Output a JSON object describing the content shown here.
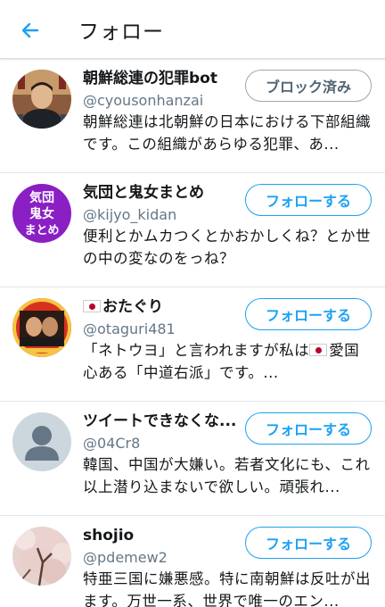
{
  "header": {
    "title": "フォロー"
  },
  "users": [
    {
      "name": "朝鮮総連の犯罪bot",
      "handle": "@cyousonhanzai",
      "bio": "朝鮮総連は北朝鮮の日本における下部組織です。この組織があらゆる犯罪、あ...",
      "button": "ブロック済み",
      "avatar": "portrait-photo-icon"
    },
    {
      "name": "気団と鬼女まとめ",
      "handle": "@kijyo_kidan",
      "bio": "便利とかムカつくとかおかしくね？とか世の中の変なのをっね？",
      "button": "フォローする",
      "avatar": "text-logo",
      "avatar_text": [
        "気団",
        "鬼女",
        "まとめ"
      ]
    },
    {
      "name": "おたぐり",
      "handle": "@otaguri481",
      "bio_before": "「ネトウヨ」と言われますが私は",
      "bio_after": "愛国心ある「中道右派」です。...",
      "button": "フォローする",
      "avatar": "portrait-photo-icon"
    },
    {
      "name": "ツイートできなくな...",
      "handle": "@04Cr8",
      "bio": "韓国、中国が大嫌い。若者文化にも、これ以上潜り込まないで欲しい。頑張れ...",
      "button": "フォローする",
      "avatar": "default-user-icon"
    },
    {
      "name": "shojio",
      "handle": "@pdemew2",
      "bio": "特亜三国に嫌悪感。特に南朝鮮は反吐が出ます。万世一系、世界で唯一のエン...",
      "button": "フォローする",
      "avatar": "cherry-blossom-photo-icon"
    }
  ],
  "colors": {
    "accent": "#1da1f2",
    "avatar_purple": "#8a1fc4",
    "default_avatar_bg": "#ccd6dd"
  }
}
